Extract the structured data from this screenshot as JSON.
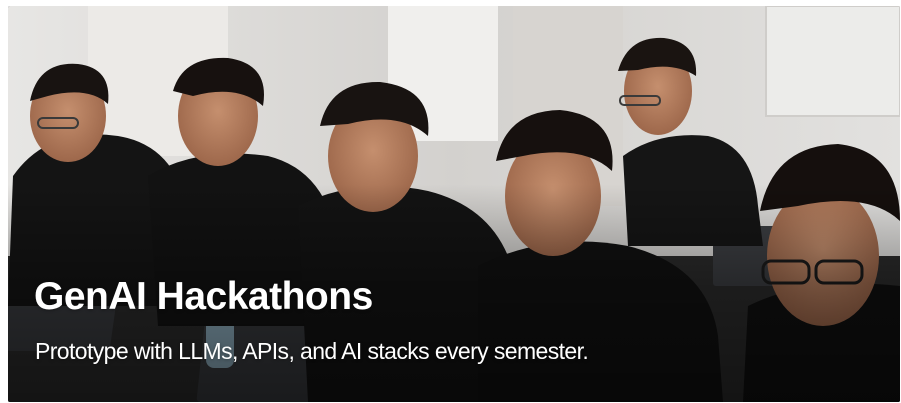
{
  "banner": {
    "title": "GenAI Hackathons",
    "subtitle": "Prototype with LLMs, APIs, and AI stacks every semester."
  },
  "photo": {
    "description_icon": "photo-students-coding",
    "colors": {
      "shirts": "#141414",
      "skin": "#b07a5c",
      "hair": "#181311",
      "background_wall": "#d9d6d2",
      "table": "#2a2a2a"
    }
  }
}
